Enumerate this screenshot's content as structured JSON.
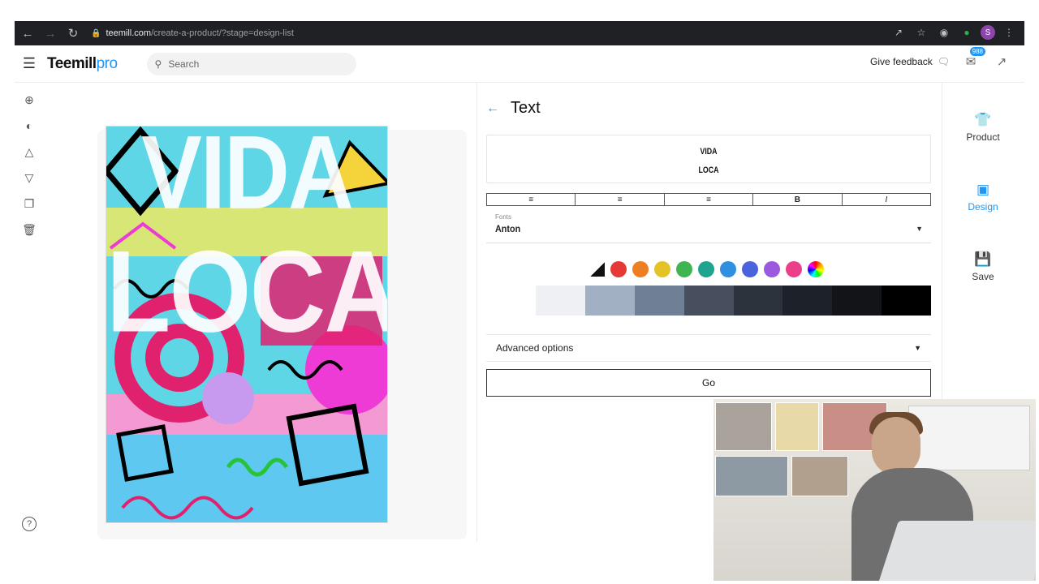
{
  "browser": {
    "url_host": "teemill.com",
    "url_path": "/create-a-product/?stage=design-list",
    "profile_initial": "S"
  },
  "header": {
    "logo_main": "Teemill",
    "logo_pro": "pro",
    "search_placeholder": "Search",
    "feedback_label": "Give feedback",
    "notification_count": "988"
  },
  "canvas": {
    "design_line1": "VIDA",
    "design_line2": "LOCA"
  },
  "panel": {
    "title": "Text",
    "text_lines": [
      "VIDA",
      "LOCA"
    ],
    "bold_label": "B",
    "italic_label": "I",
    "font_label": "Fonts",
    "font_value": "Anton",
    "advanced_label": "Advanced options",
    "go_label": "Go",
    "swatch_colors": [
      "#e53935",
      "#ef7d22",
      "#e6c229",
      "#3fb552",
      "#1fa58f",
      "#2f8fe0",
      "#4a63dd",
      "#9b59e0",
      "#ec3f8a"
    ],
    "shade_colors": [
      "#eef0f4",
      "#a2b0c4",
      "#6f7f96",
      "#474f5e",
      "#2d333d",
      "#1d2129",
      "#121418",
      "#000000"
    ]
  },
  "rail": {
    "product_label": "Product",
    "design_label": "Design",
    "save_label": "Save"
  },
  "colors": {
    "accent": "#2196f3"
  }
}
